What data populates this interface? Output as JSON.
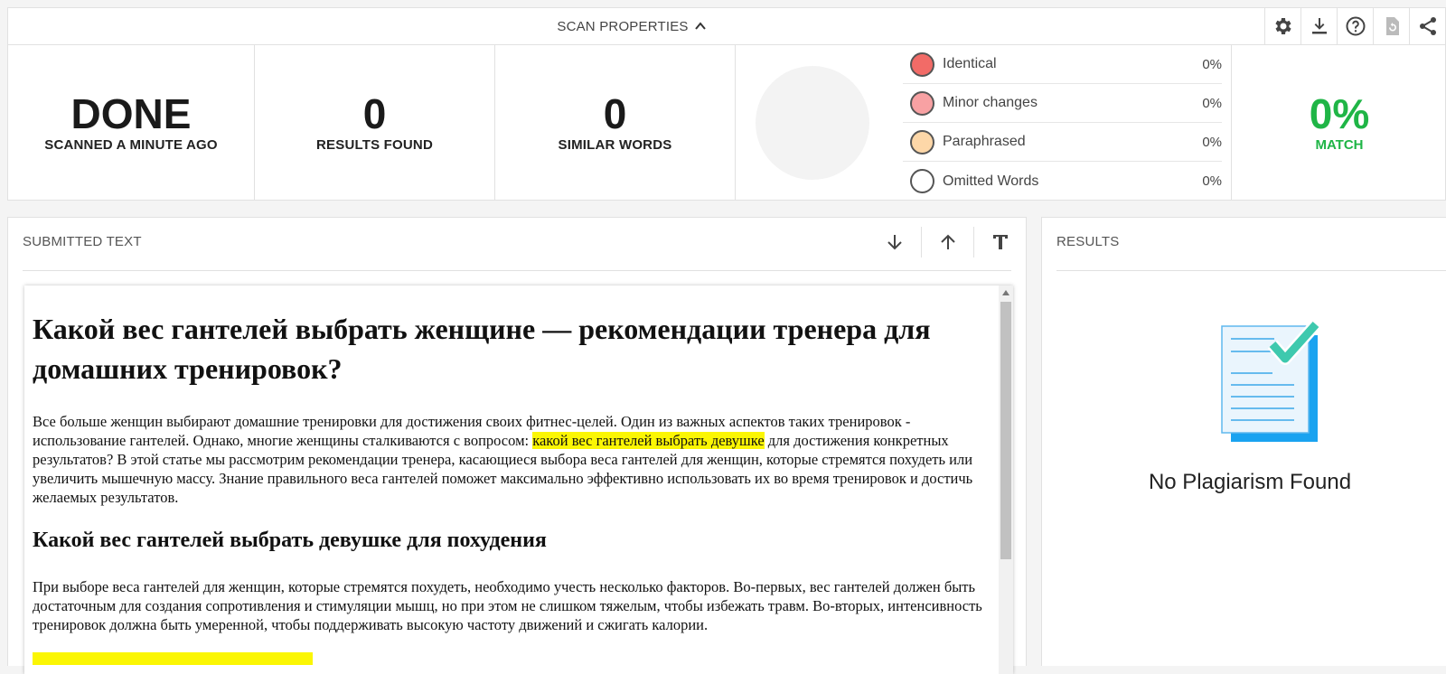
{
  "header": {
    "toggle_label": "SCAN PROPERTIES",
    "toolbar": [
      "settings-gear-icon",
      "download-icon",
      "help-icon",
      "rescan-icon",
      "share-icon"
    ]
  },
  "stats": {
    "status": {
      "value": "DONE",
      "label": "SCANNED A MINUTE AGO"
    },
    "results": {
      "value": "0",
      "label": "RESULTS FOUND"
    },
    "similar": {
      "value": "0",
      "label": "SIMILAR WORDS"
    },
    "legend": [
      {
        "label": "Identical",
        "pct": "0%",
        "color": "#f26b67"
      },
      {
        "label": "Minor changes",
        "pct": "0%",
        "color": "#f8a1a3"
      },
      {
        "label": "Paraphrased",
        "pct": "0%",
        "color": "#fdd7a8"
      },
      {
        "label": "Omitted Words",
        "pct": "0%",
        "color": "#ffffff"
      }
    ],
    "match": {
      "value": "0%",
      "label": "MATCH",
      "color": "#1fb546"
    }
  },
  "submitted": {
    "title": "SUBMITTED TEXT",
    "tools": [
      "arrow-down-icon",
      "arrow-up-icon",
      "text-format-icon"
    ],
    "heading": "Какой вес гантелей выбрать женщине — рекомендации тренера для домашних тренировок?",
    "p1_before": "Все больше женщин выбирают домашние тренировки для достижения своих фитнес-целей. Один из важных аспектов таких тренировок - использование гантелей. Однако, многие женщины сталкиваются с вопросом: ",
    "p1_highlight": "какой вес гантелей выбрать девушке",
    "p1_after": " для достижения конкретных результатов? В этой статье мы рассмотрим рекомендации тренера, касающиеся выбора веса гантелей для женщин, которые стремятся похудеть или увеличить мышечную массу. Знание правильного веса гантелей поможет максимально эффективно использовать их во время тренировок и достичь желаемых результатов.",
    "subheading": "Какой вес гантелей выбрать девушке для похудения",
    "p2": "При выборе веса гантелей для женщин, которые стремятся похудеть, необходимо учесть несколько факторов. Во-первых, вес гантелей должен быть достаточным для создания сопротивления и стимуляции мышц, но при этом не слишком тяжелым, чтобы избежать травм. Во-вторых, интенсивность тренировок должна быть умеренной, чтобы поддерживать высокую частоту движений и сжигать калории.",
    "highlight_color": "#fbf604"
  },
  "results": {
    "title": "RESULTS",
    "message": "No Plagiarism Found"
  }
}
